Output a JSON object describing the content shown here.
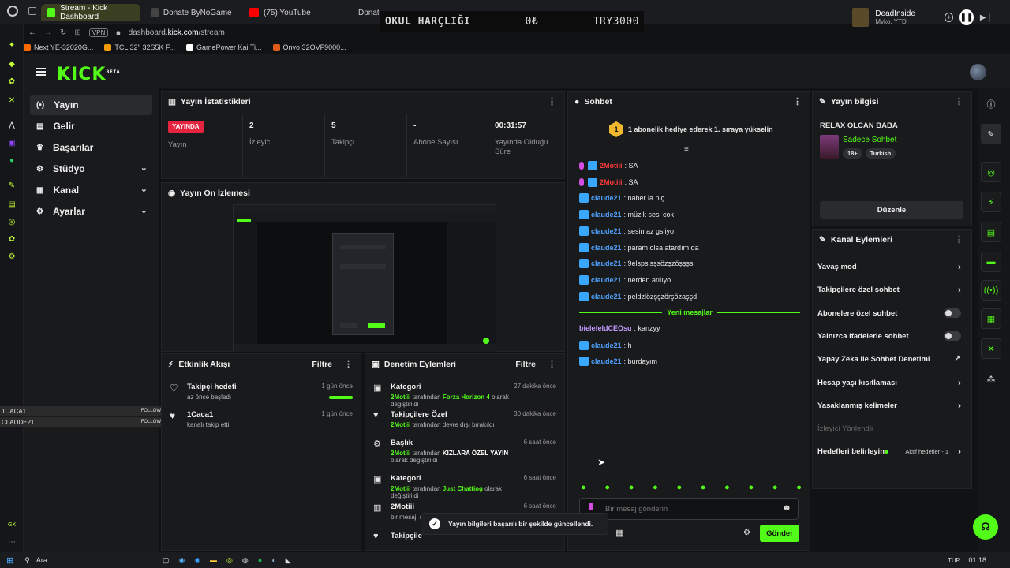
{
  "browser": {
    "tabs": [
      {
        "label": "Stream - Kick Dashboard",
        "active": true
      },
      {
        "label": "Donate ByNoGame - 2M...",
        "active": false
      },
      {
        "label": "(75) YouTube",
        "active": false
      },
      {
        "label": "Donate ByNoGame - St...",
        "active": false
      }
    ],
    "url_prefix": "dashboard.",
    "url_domain": "kick.com",
    "url_path": "/stream",
    "vpn": "VPN",
    "bookmarks": [
      "Next YE-32020G...",
      "TCL 32'' 32S5K F...",
      "GamePower Kai Ti...",
      "Onvo 32OVF9000..."
    ]
  },
  "overlay": {
    "label": "OKUL HARÇLIĞI",
    "current": "0₺",
    "goal": "TRY3000"
  },
  "spotify": {
    "track": "DeadInside",
    "artist": "Mvko, YTD"
  },
  "sidebar": {
    "items": [
      {
        "label": "Yayın",
        "icon": "broadcast-icon",
        "active": true
      },
      {
        "label": "Gelir",
        "icon": "chart-icon"
      },
      {
        "label": "Başarılar",
        "icon": "trophy-icon"
      },
      {
        "label": "Stüdyo",
        "icon": "gear-icon",
        "expand": true
      },
      {
        "label": "Kanal",
        "icon": "channel-icon",
        "expand": true
      },
      {
        "label": "Ayarlar",
        "icon": "settings-icon",
        "expand": true
      }
    ],
    "follow_rows": [
      {
        "name": "1CACA1",
        "action": "FOLLOW"
      },
      {
        "name": "CLAUDE21",
        "action": "FOLLOW"
      }
    ]
  },
  "stats": {
    "title": "Yayın İstatistikleri",
    "live_badge": "YAYINDA",
    "items": [
      {
        "value": "",
        "label": "Yayın"
      },
      {
        "value": "2",
        "label": "İzleyici"
      },
      {
        "value": "5",
        "label": "Takipçi"
      },
      {
        "value": "-",
        "label": "Abone Sayısı"
      },
      {
        "value": "00:31:57",
        "label": "Yayında Olduğu Süre"
      }
    ]
  },
  "preview": {
    "title": "Yayın Ön İzlemesi"
  },
  "activity": {
    "title": "Etkinlik Akışı",
    "filter": "Filtre",
    "items": [
      {
        "title": "Takipçi hedefi",
        "sub": "az önce başladı",
        "time": "1 gün önce",
        "progress": 1.0
      },
      {
        "title": "1Caca1",
        "sub": "kanalı takip etti",
        "time": "1 gün önce"
      }
    ]
  },
  "moderation": {
    "title": "Denetim Eylemleri",
    "filter": "Filtre",
    "items": [
      {
        "title": "Kategori",
        "user": "2Motiii",
        "mid": " tarafından ",
        "value": "Forza Horizon 4",
        "tail": " olarak değiştirildi",
        "time": "27 dakika önce"
      },
      {
        "title": "Takipçilere Özel",
        "user": "2Motiii",
        "mid": " tarafından devre dışı bırakıldı",
        "value": "",
        "tail": "",
        "time": "30 dakika önce"
      },
      {
        "title": "Başlık",
        "user": "2Motiii",
        "mid": " tarafından ",
        "value": "KIZLARA ÖZEL YAYIN",
        "tail": " olarak değiştirildi",
        "time": "6 saat önce"
      },
      {
        "title": "Kategori",
        "user": "2Motiii",
        "mid": " tarafından ",
        "value": "Just Chatting",
        "tail": " olarak değiştirildi",
        "time": "6 saat önce"
      },
      {
        "title": "2Motiii",
        "user": "",
        "mid": "bir mesajı s",
        "value": "",
        "tail": "",
        "time": "6 saat önce"
      },
      {
        "title": "Takipçile",
        "user": "",
        "mid": "",
        "value": "",
        "tail": "",
        "time": ""
      }
    ]
  },
  "chat": {
    "title": "Sohbet",
    "gift_text": "1 abonelik hediye ederek 1. sıraya yükselin",
    "gift_rank": "1",
    "messages": [
      {
        "user": "2Motiii",
        "color": "red",
        "text": ": SA"
      },
      {
        "user": "2Motiii",
        "color": "red",
        "text": ": SA"
      },
      {
        "user": "claude21",
        "color": "blue",
        "text": ": naber la piç"
      },
      {
        "user": "claude21",
        "color": "blue",
        "text": ": müzik sesi cok"
      },
      {
        "user": "claude21",
        "color": "blue",
        "text": ": sesin az gsliyo"
      },
      {
        "user": "claude21",
        "color": "blue",
        "text": ": param olsa atardım da"
      },
      {
        "user": "claude21",
        "color": "blue",
        "text": ": 9elspslsşsözşzöşşşs"
      },
      {
        "user": "claude21",
        "color": "blue",
        "text": ": nerden atılıyo"
      },
      {
        "user": "claude21",
        "color": "blue",
        "text": ": peldzlözşşzörşözaşşd"
      }
    ],
    "new_messages_label": "Yeni mesajlar",
    "new_messages": [
      {
        "user": "bielefeldCEOsu",
        "color": "purple",
        "text": ": kanzyy"
      },
      {
        "user": "claude21",
        "color": "blue",
        "text": ": h"
      },
      {
        "user": "claude21",
        "color": "blue",
        "text": ": burdayım"
      }
    ],
    "input_placeholder": "Bir mesaj gönderin",
    "send_label": "Gönder"
  },
  "toast": {
    "text": "Yayın bilgileri başarılı bir şekilde güncellendi."
  },
  "stream_info": {
    "title": "Yayın bilgisi",
    "stream_title": "RELAX OLCAN BABA",
    "category": "Sadece Sohbet",
    "tags": [
      "18+",
      "Turkish"
    ],
    "edit_label": "Düzenle"
  },
  "channel_actions": {
    "title": "Kanal Eylemleri",
    "items": [
      {
        "label": "Yavaş mod",
        "control": "arrow"
      },
      {
        "label": "Takipçilere özel sohbet",
        "control": "arrow"
      },
      {
        "label": "Abonelere özel sohbet",
        "control": "toggle"
      },
      {
        "label": "Yalnızca ifadelerle sohbet",
        "control": "toggle"
      },
      {
        "label": "Yapay Zeka ile Sohbet Denetimi",
        "control": "external"
      },
      {
        "label": "Hesap yaşı kısıtlaması",
        "control": "arrow"
      },
      {
        "label": "Yasaklanmış kelimeler",
        "control": "arrow"
      },
      {
        "label": "İzleyici Yönlendir",
        "control": "none",
        "disabled": true
      },
      {
        "label": "Hedefleri belirleyin",
        "control": "arrow",
        "extra": "Aktif hedefler - 1"
      }
    ]
  },
  "taskbar": {
    "search": "Ara",
    "time": "01:18",
    "lang": "TUR"
  },
  "colors": {
    "accent": "#53fc18",
    "live": "#e6243f",
    "panel": "#191a1c"
  }
}
